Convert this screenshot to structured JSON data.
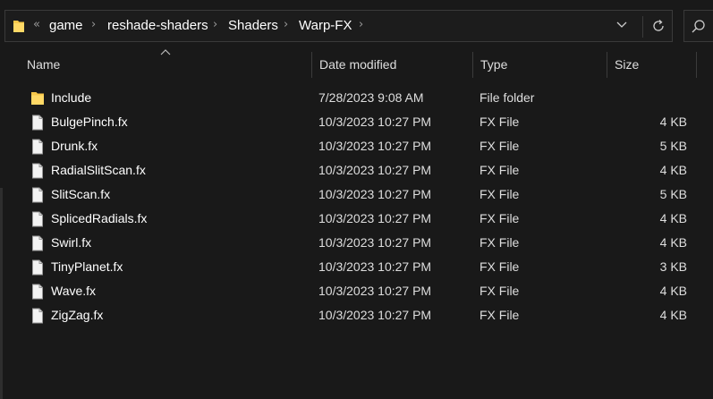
{
  "address_bar": {
    "overflow_glyph": "«",
    "crumbs": [
      "game",
      "reshade-shaders",
      "Shaders",
      "Warp-FX"
    ],
    "separator_glyph": "›",
    "icons": [
      "folder-icon",
      "chevron-down-icon",
      "refresh-icon",
      "search-icon"
    ]
  },
  "columns": {
    "name": "Name",
    "date": "Date modified",
    "type": "Type",
    "size": "Size"
  },
  "files": [
    {
      "name": "Include",
      "date": "7/28/2023 9:08 AM",
      "type": "File folder",
      "size": "",
      "icon": "folder-icon"
    },
    {
      "name": "BulgePinch.fx",
      "date": "10/3/2023 10:27 PM",
      "type": "FX File",
      "size": "4 KB",
      "icon": "file-icon"
    },
    {
      "name": "Drunk.fx",
      "date": "10/3/2023 10:27 PM",
      "type": "FX File",
      "size": "5 KB",
      "icon": "file-icon"
    },
    {
      "name": "RadialSlitScan.fx",
      "date": "10/3/2023 10:27 PM",
      "type": "FX File",
      "size": "4 KB",
      "icon": "file-icon"
    },
    {
      "name": "SlitScan.fx",
      "date": "10/3/2023 10:27 PM",
      "type": "FX File",
      "size": "5 KB",
      "icon": "file-icon"
    },
    {
      "name": "SplicedRadials.fx",
      "date": "10/3/2023 10:27 PM",
      "type": "FX File",
      "size": "4 KB",
      "icon": "file-icon"
    },
    {
      "name": "Swirl.fx",
      "date": "10/3/2023 10:27 PM",
      "type": "FX File",
      "size": "4 KB",
      "icon": "file-icon"
    },
    {
      "name": "TinyPlanet.fx",
      "date": "10/3/2023 10:27 PM",
      "type": "FX File",
      "size": "3 KB",
      "icon": "file-icon"
    },
    {
      "name": "Wave.fx",
      "date": "10/3/2023 10:27 PM",
      "type": "FX File",
      "size": "4 KB",
      "icon": "file-icon"
    },
    {
      "name": "ZigZag.fx",
      "date": "10/3/2023 10:27 PM",
      "type": "FX File",
      "size": "4 KB",
      "icon": "file-icon"
    }
  ],
  "colors": {
    "background": "#191919",
    "text": "#ffffff",
    "folder": "#f8c84a"
  }
}
